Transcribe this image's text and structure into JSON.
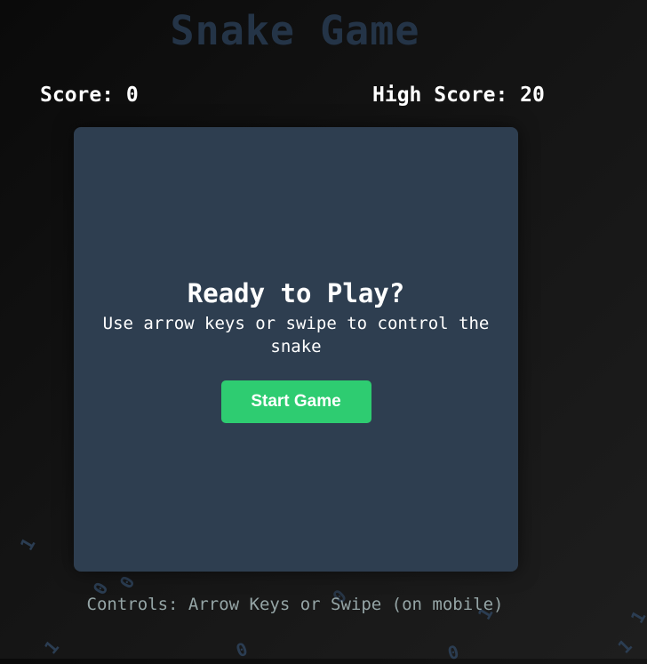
{
  "title": "Snake Game",
  "score": {
    "label": "Score: 0"
  },
  "high_score": {
    "label": "High Score: 20"
  },
  "overlay": {
    "heading": "Ready to Play?",
    "subtitle": "Use arrow keys or swipe to control the snake",
    "start_button_label": "Start Game"
  },
  "controls_text": "Controls: Arrow Keys or Swipe (on mobile)",
  "background_digits": [
    "1",
    "0",
    "0",
    "0",
    "1",
    "1",
    "0",
    "0",
    "1",
    "1"
  ],
  "colors": {
    "board": "#2e3e50",
    "title": "#243447",
    "button": "#2ecc71",
    "controls_text": "#95a5a6",
    "digits": "#2b3d52"
  }
}
